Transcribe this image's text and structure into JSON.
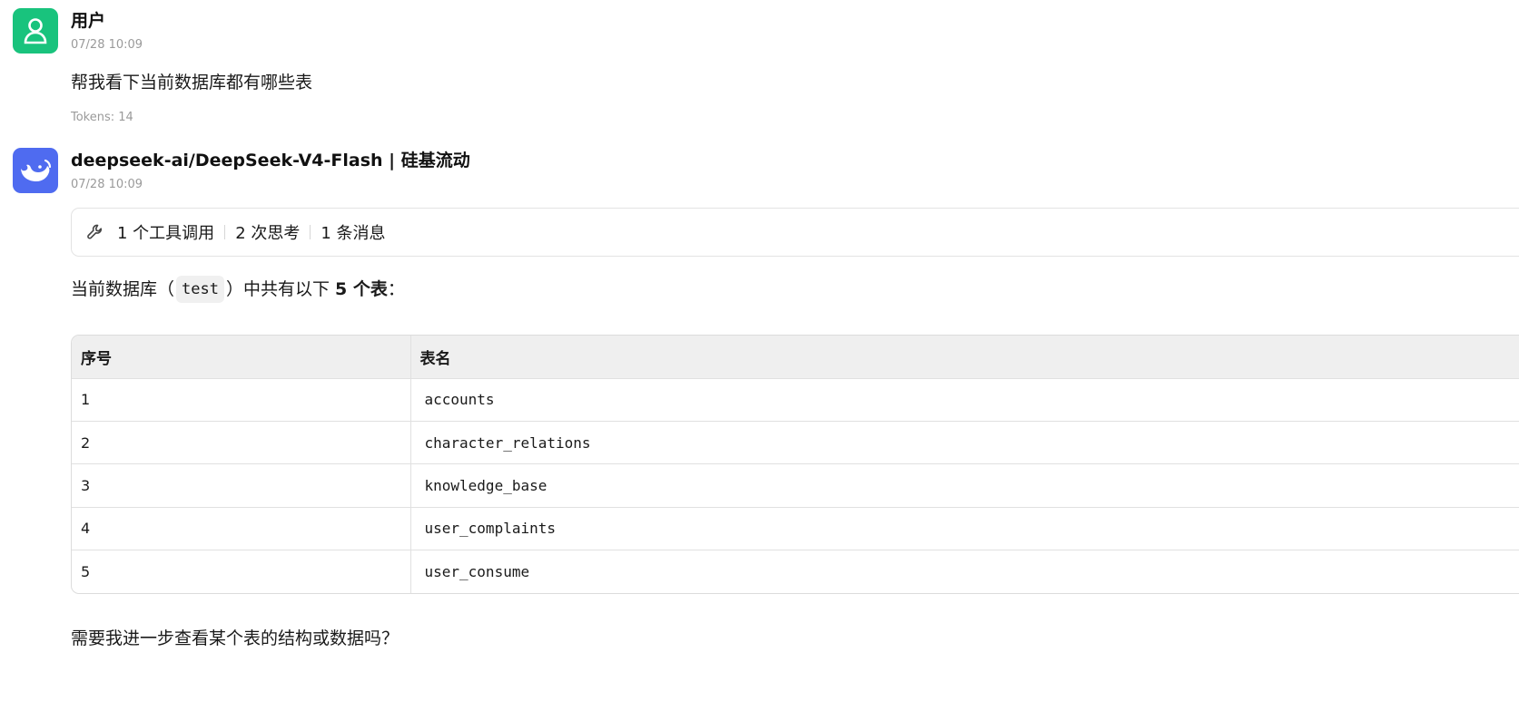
{
  "user_message": {
    "sender": "用户",
    "timestamp": "07/28 10:09",
    "text": "帮我看下当前数据库都有哪些表",
    "tokens": "Tokens: 14"
  },
  "assistant_message": {
    "sender": "deepseek-ai/DeepSeek-V4-Flash | 硅基流动",
    "timestamp": "07/28 10:09",
    "tool_summary": {
      "icon": "wrench-icon",
      "tool_calls": "1 个工具调用",
      "thinking": "2 次思考",
      "messages": "1 条消息"
    },
    "intro_before": "当前数据库（",
    "db_name": "test",
    "intro_middle": "）中共有以下 ",
    "intro_bold": "5 个表",
    "intro_after": "：",
    "table": {
      "headers": [
        "序号",
        "表名"
      ],
      "rows": [
        [
          "1",
          "accounts"
        ],
        [
          "2",
          "character_relations"
        ],
        [
          "3",
          "knowledge_base"
        ],
        [
          "4",
          "user_complaints"
        ],
        [
          "5",
          "user_consume"
        ]
      ]
    },
    "closing": "需要我进一步查看某个表的结构或数据吗？"
  },
  "colors": {
    "user_avatar": "#19c37d",
    "bot_avatar": "#4f6bf0"
  }
}
